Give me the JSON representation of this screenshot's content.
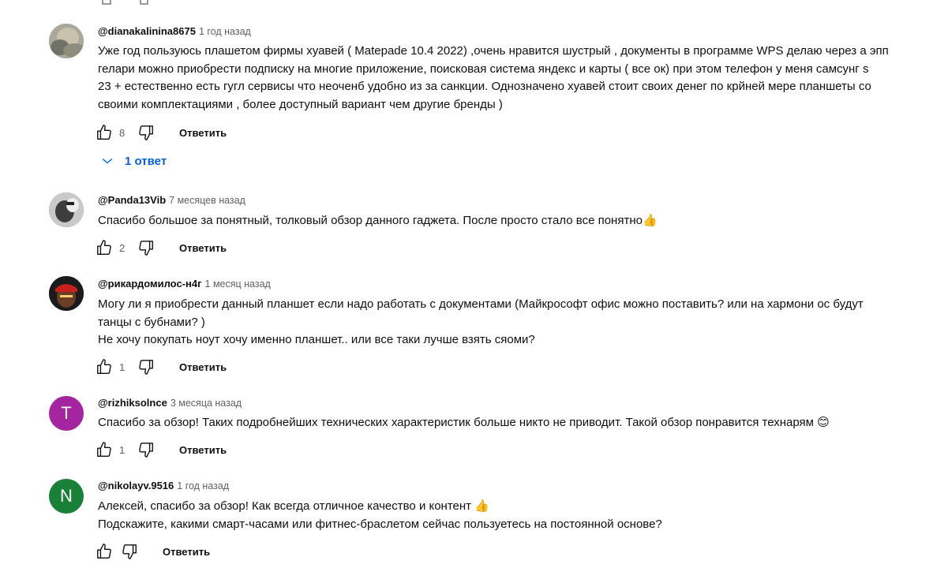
{
  "colors": {
    "link": "#065fd4",
    "text": "#0f0f0f",
    "meta": "#606060"
  },
  "comments": [
    {
      "author": "@dianakalinina8675",
      "time": "1 год назад",
      "lines": [
        "Уже год пользуюсь плашетом фирмы хуавей ( Matepade 10.4 2022)  ,очень нравится шустрый , документы в программе WPS делаю через а эпп",
        "гелари можно приобрести подписку на многие приложение, поисковая система яндекс и карты ( все ок)  при этом телефон у меня самсунг s",
        "23 + естественно есть гугл сервисы что неоченб удобно из за санкции. Однозначено хуавей стоит своих денег по крйней мере планшеты со",
        "своими комплектациями , более доступный вариант чем другие бренды )"
      ],
      "likes": "8",
      "reply_label": "Ответить",
      "replies_label": "1 ответ",
      "avatar_icon": "photo-avatar"
    },
    {
      "author": "@Panda13Vib",
      "time": "7 месяцев назад",
      "lines": [
        "Спасибо большое за понятный, толковый обзор данного гаджета. После просто стало все понятно"
      ],
      "emoji": "👍",
      "likes": "2",
      "reply_label": "Ответить",
      "avatar_icon": "photo-avatar"
    },
    {
      "author": "@рикардомилос-н4г",
      "time": "1 месяц назад",
      "lines": [
        "Могу ли я приобрести данный планшет если надо работать с документами (Майкрософт офис можно поставить? или на хармони ос будут",
        "танцы с бубнами? )",
        "Не хочу покупать ноут хочу именно планшет.. или все таки лучше взять сяоми?"
      ],
      "likes": "1",
      "reply_label": "Ответить",
      "avatar_icon": "photo-avatar"
    },
    {
      "author": "@rizhiksolnce",
      "time": "3 месяца назад",
      "lines": [
        "Спасибо за обзор! Таких подробнейших технических характеристик больше никто не приводит. Такой обзор понравится технарям "
      ],
      "emoji": "😊",
      "likes": "1",
      "reply_label": "Ответить",
      "avatar_letter": "T",
      "avatar_color": "#a5249f"
    },
    {
      "author": "@nikolayv.9516",
      "time": "1 год назад",
      "lines": [
        "Алексей, спасибо за обзор! Как всегда отличное качество и контент ",
        "Подскажите, какими смарт-часами или фитнес-браслетом сейчас пользуетесь на постоянной основе?"
      ],
      "emoji": "👍",
      "likes": "",
      "reply_label": "Ответить",
      "avatar_letter": "N",
      "avatar_color": "#1a7f37"
    }
  ]
}
